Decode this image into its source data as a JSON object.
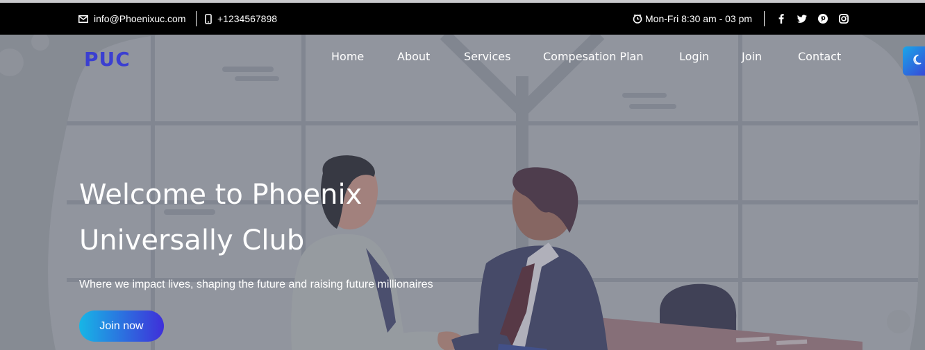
{
  "topbar": {
    "email": "info@Phoenixuc.com",
    "phone": "+1234567898",
    "hours": "Mon-Fri 8:30 am - 03 pm",
    "icons": {
      "email": "mail-icon",
      "phone": "phone-icon",
      "hours": "clock-icon",
      "social": [
        "facebook-icon",
        "twitter-icon",
        "pinterest-icon",
        "instagram-icon"
      ]
    }
  },
  "header": {
    "logo": "PUC",
    "nav": [
      "Home",
      "About",
      "Services",
      "Compesation Plan",
      "Login",
      "Join",
      "Contact"
    ]
  },
  "hero": {
    "title_line1": "Welcome to Phoenix",
    "title_line2": "Universally Club",
    "subtitle": "Where we impact lives, shaping the future and raising future millionaires",
    "cta": "Join now"
  },
  "theme_toggle": {
    "icon": "moon-icon"
  },
  "colors": {
    "topbar_bg": "#000000",
    "logo": "#3b3fd1",
    "cta_gradient_start": "#17b6e6",
    "cta_gradient_end": "#3f2fd9"
  }
}
